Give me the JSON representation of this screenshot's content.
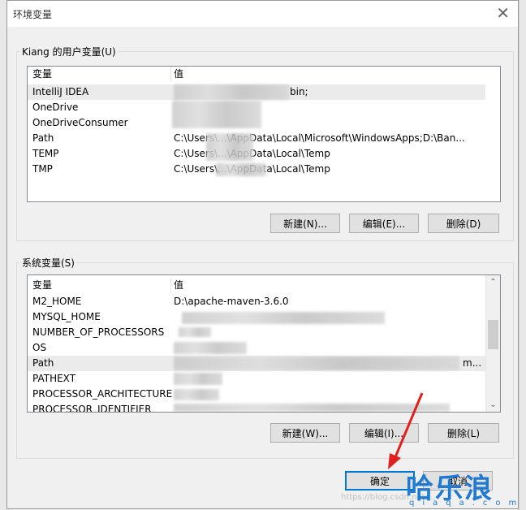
{
  "window": {
    "title": "环境变量",
    "close_glyph": "✕"
  },
  "user_vars": {
    "legend": "Kiang 的用户变量(U)",
    "header": {
      "col1": "变量",
      "col2": "值"
    },
    "rows": [
      {
        "name": "IntelliJ IDEA",
        "value": "bin;"
      },
      {
        "name": "OneDrive",
        "value": ""
      },
      {
        "name": "OneDriveConsumer",
        "value": ""
      },
      {
        "name": "Path",
        "value": "C:\\Users\\...\\AppData\\Local\\Microsoft\\WindowsApps;D:\\Ban..."
      },
      {
        "name": "TEMP",
        "value": "C:\\Users\\...\\AppData\\Local\\Temp"
      },
      {
        "name": "TMP",
        "value": "C:\\Users\\...\\AppData\\Local\\Temp"
      }
    ],
    "buttons": {
      "new": "新建(N)...",
      "edit": "编辑(E)...",
      "delete": "删除(D)"
    }
  },
  "system_vars": {
    "legend": "系统变量(S)",
    "header": {
      "col1": "变量",
      "col2": "值"
    },
    "rows": [
      {
        "name": "M2_HOME",
        "value": "D:\\apache-maven-3.6.0"
      },
      {
        "name": "MYSQL_HOME",
        "value": ""
      },
      {
        "name": "NUMBER_OF_PROCESSORS",
        "value": ""
      },
      {
        "name": "OS",
        "value": ""
      },
      {
        "name": "Path",
        "value": "m..."
      },
      {
        "name": "PATHEXT",
        "value": ""
      },
      {
        "name": "PROCESSOR_ARCHITECTURE",
        "value": ""
      },
      {
        "name": "PROCESSOR_IDENTIFIER",
        "value": ""
      }
    ],
    "buttons": {
      "new": "新建(W)...",
      "edit": "编辑(I)...",
      "delete": "删除(L)"
    }
  },
  "footer": {
    "ok": "确定",
    "cancel": "取消"
  },
  "watermark": {
    "brand": "哈乐浪",
    "domain": "qiaqa.com",
    "url": "https://blog.csdn.net/..."
  },
  "colors": {
    "accent": "#0078d7",
    "annotation_arrow": "#e0201c",
    "watermark": "#1f7bd1"
  }
}
